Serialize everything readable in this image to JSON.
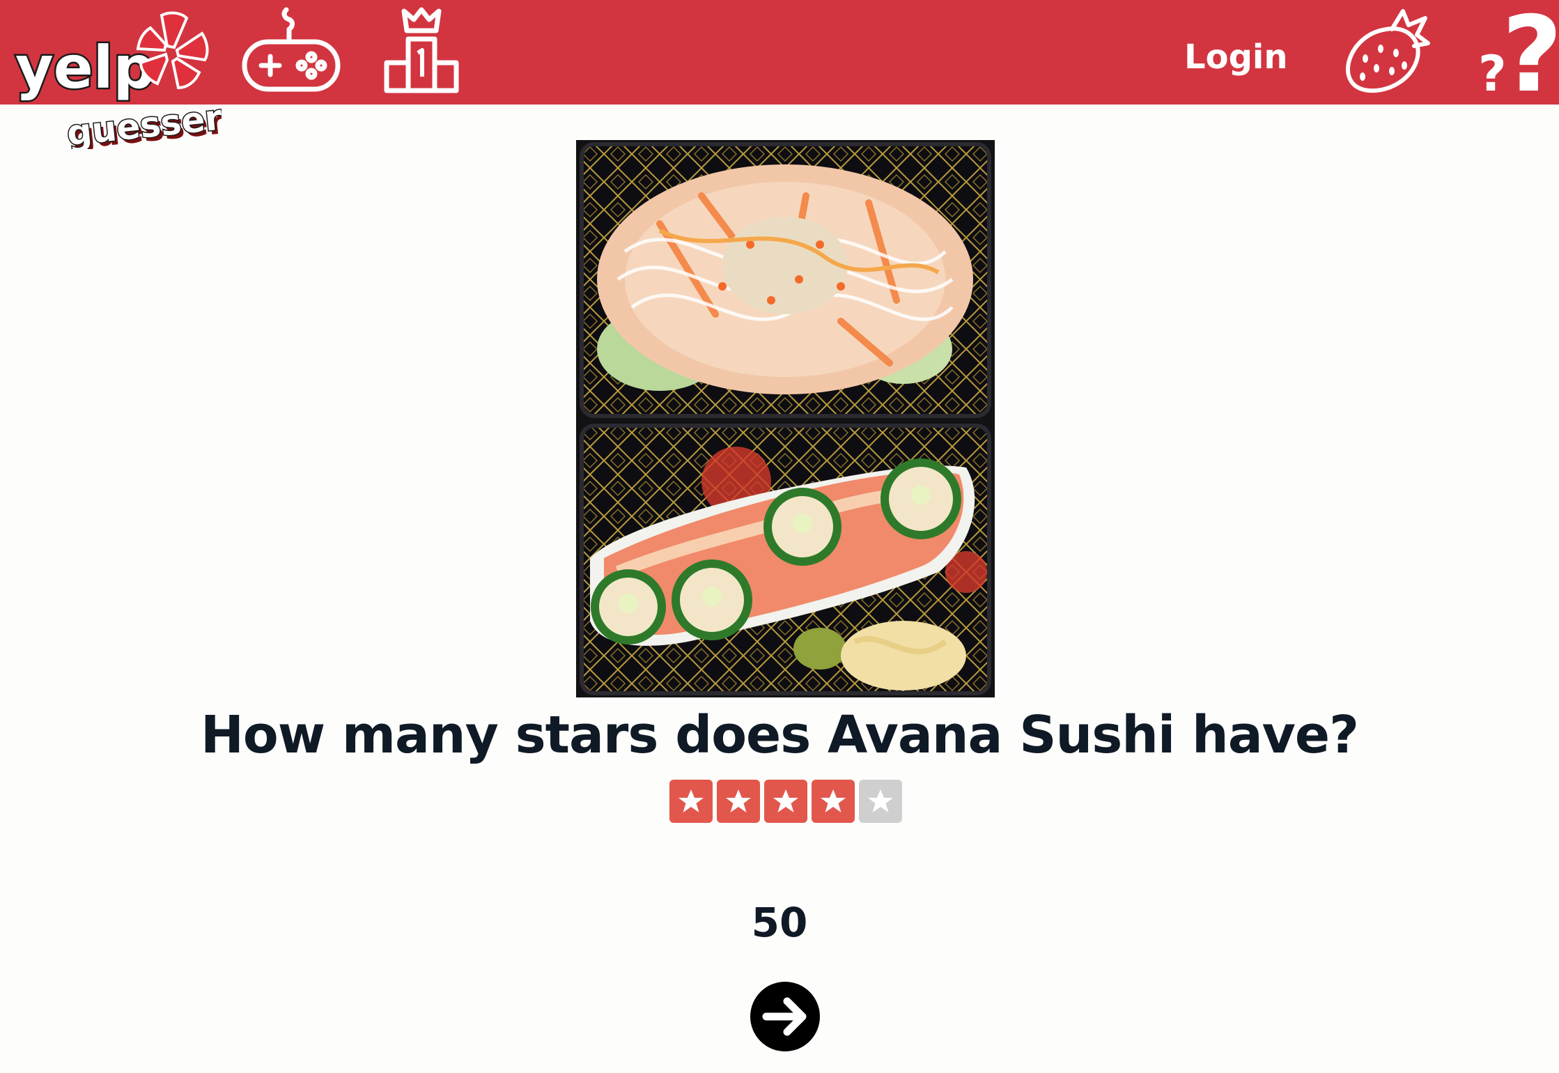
{
  "header": {
    "brand": "yelp",
    "sub_brand": "guesser",
    "login_label": "Login",
    "icons": [
      "gamepad-icon",
      "leaderboard-icon",
      "strawberry-icon",
      "help-icon"
    ]
  },
  "colors": {
    "header_bg": "#d23540",
    "star_filled": "#e2574c",
    "star_empty": "#cfcfcf",
    "text_dark": "#0f1a26"
  },
  "main": {
    "question": "How many stars does Avana Sushi have?",
    "rating": 4,
    "rating_max": 5,
    "score": "50"
  }
}
